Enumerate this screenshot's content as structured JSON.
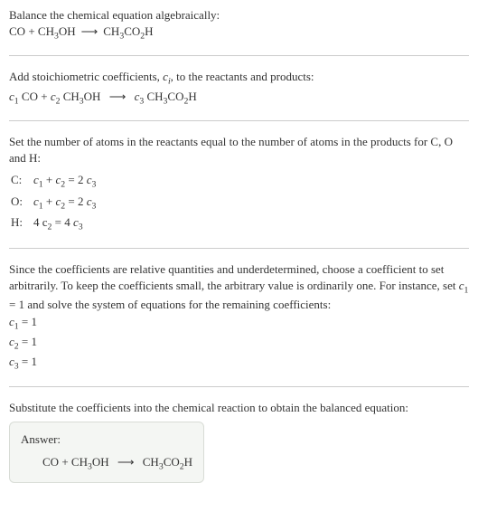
{
  "section1": {
    "title": "Balance the chemical equation algebraically:",
    "r1": "CO",
    "add1": "+",
    "r2a": "CH",
    "r2b": "3",
    "r2c": "OH",
    "arrow": "⟶",
    "p1a": "CH",
    "p1b": "3",
    "p1c": "CO",
    "p1d": "2",
    "p1e": "H"
  },
  "section2": {
    "title_a": "Add stoichiometric coefficients, ",
    "title_c": "c",
    "title_ci": "i",
    "title_b": ", to the reactants and products:",
    "c1": "c",
    "c1s": "1",
    "r1": " CO",
    "add1": " + ",
    "c2": "c",
    "c2s": "2",
    "r2a": " CH",
    "r2b": "3",
    "r2c": "OH ",
    "arrow": "⟶",
    "c3": " c",
    "c3s": "3",
    "p1a": " CH",
    "p1b": "3",
    "p1c": "CO",
    "p1d": "2",
    "p1e": "H"
  },
  "section3": {
    "title": "Set the number of atoms in the reactants equal to the number of atoms in the products for C, O and H:",
    "rows": [
      {
        "elem": "C:",
        "lhs_a": "c",
        "lhs_as": "1",
        "lhs_plus": " + ",
        "lhs_b": "c",
        "lhs_bs": "2",
        "eq": " = 2 ",
        "rhs": "c",
        "rhss": "3"
      },
      {
        "elem": "O:",
        "lhs_a": "c",
        "lhs_as": "1",
        "lhs_plus": " + ",
        "lhs_b": "c",
        "lhs_bs": "2",
        "eq": " = 2 ",
        "rhs": "c",
        "rhss": "3"
      },
      {
        "elem": "H:",
        "lhs_a": "4 c",
        "lhs_as": "2",
        "lhs_plus": "",
        "lhs_b": "",
        "lhs_bs": "",
        "eq": " = 4 ",
        "rhs": "c",
        "rhss": "3"
      }
    ]
  },
  "section4": {
    "text_a": "Since the coefficients are relative quantities and underdetermined, choose a coefficient to set arbitrarily. To keep the coefficients small, the arbitrary value is ordinarily one. For instance, set ",
    "cvar": "c",
    "cvars": "1",
    "text_b": " = 1 and solve the system of equations for the remaining coefficients:",
    "coeffs": [
      {
        "c": "c",
        "cs": "1",
        "val": " = 1"
      },
      {
        "c": "c",
        "cs": "2",
        "val": " = 1"
      },
      {
        "c": "c",
        "cs": "3",
        "val": " = 1"
      }
    ]
  },
  "section5": {
    "title": "Substitute the coefficients into the chemical reaction to obtain the balanced equation:",
    "answer_label": "Answer:",
    "r1": "CO",
    "add1": " + ",
    "r2a": "CH",
    "r2b": "3",
    "r2c": "OH ",
    "arrow": "⟶",
    "p1a": " CH",
    "p1b": "3",
    "p1c": "CO",
    "p1d": "2",
    "p1e": "H"
  }
}
